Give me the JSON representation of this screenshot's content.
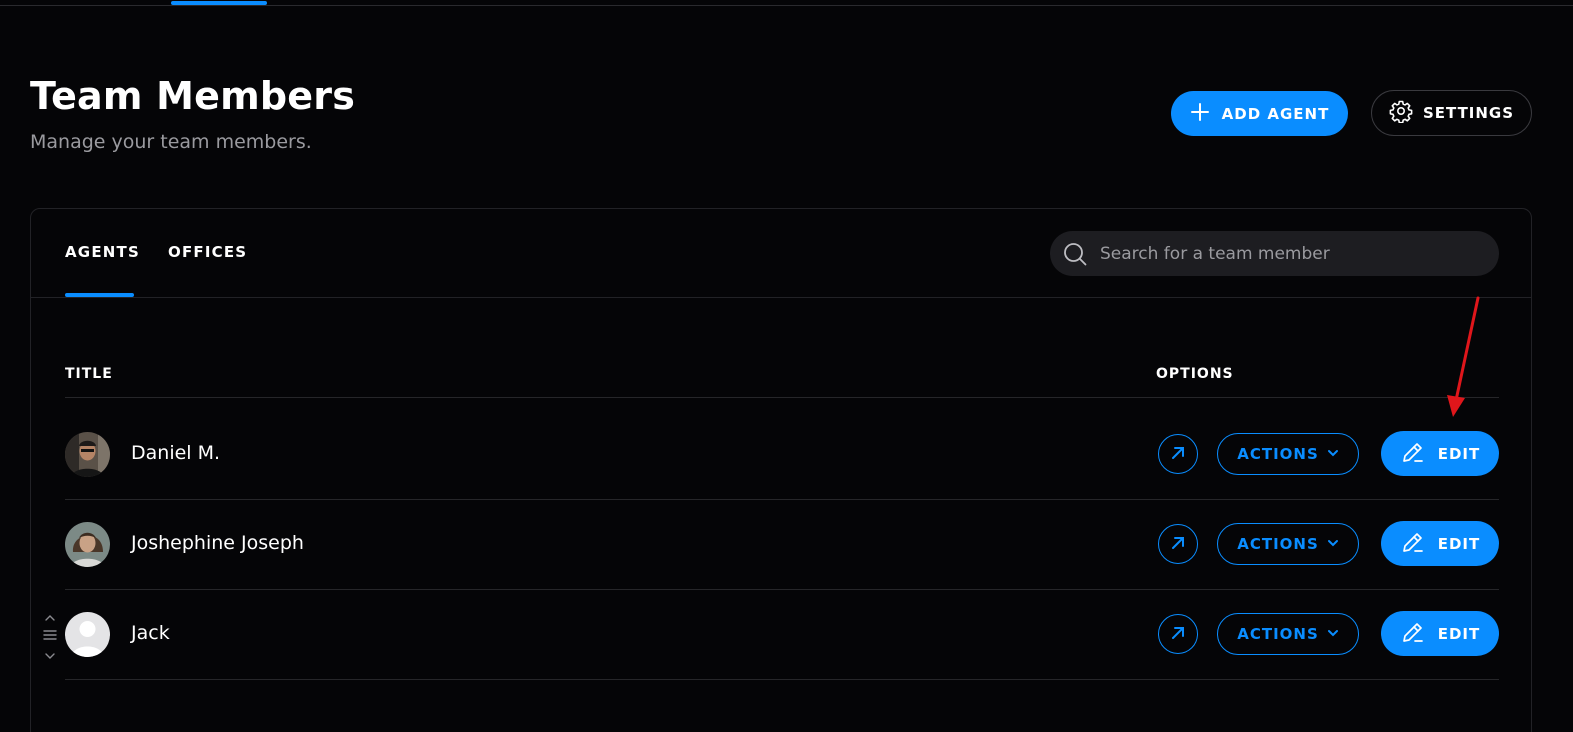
{
  "header": {
    "title": "Team Members",
    "subtitle": "Manage your team members.",
    "add_agent_label": "ADD AGENT",
    "settings_label": "SETTINGS"
  },
  "tabs": [
    {
      "label": "AGENTS",
      "active": true
    },
    {
      "label": "OFFICES",
      "active": false
    }
  ],
  "search": {
    "placeholder": "Search for a team member",
    "value": ""
  },
  "table": {
    "columns": {
      "title": "TITLE",
      "options": "OPTIONS"
    },
    "rows": [
      {
        "name": "Daniel M.",
        "avatar": "photo-daniel",
        "actions_label": "ACTIONS",
        "edit_label": "EDIT"
      },
      {
        "name": "Joshephine Joseph",
        "avatar": "photo-josephine",
        "actions_label": "ACTIONS",
        "edit_label": "EDIT"
      },
      {
        "name": "Jack",
        "avatar": "default-avatar",
        "actions_label": "ACTIONS",
        "edit_label": "EDIT"
      }
    ]
  },
  "icons": {
    "add": "plus-icon",
    "settings": "gear-icon",
    "search": "search-icon",
    "open": "arrow-up-right-icon",
    "dropdown": "chevron-down-icon",
    "edit": "pencil-icon",
    "reorder": "drag-handle-icon"
  },
  "colors": {
    "accent": "#0a8dff",
    "background": "#050507",
    "muted_text": "#9a9a9f",
    "annotation": "#e0161b"
  }
}
